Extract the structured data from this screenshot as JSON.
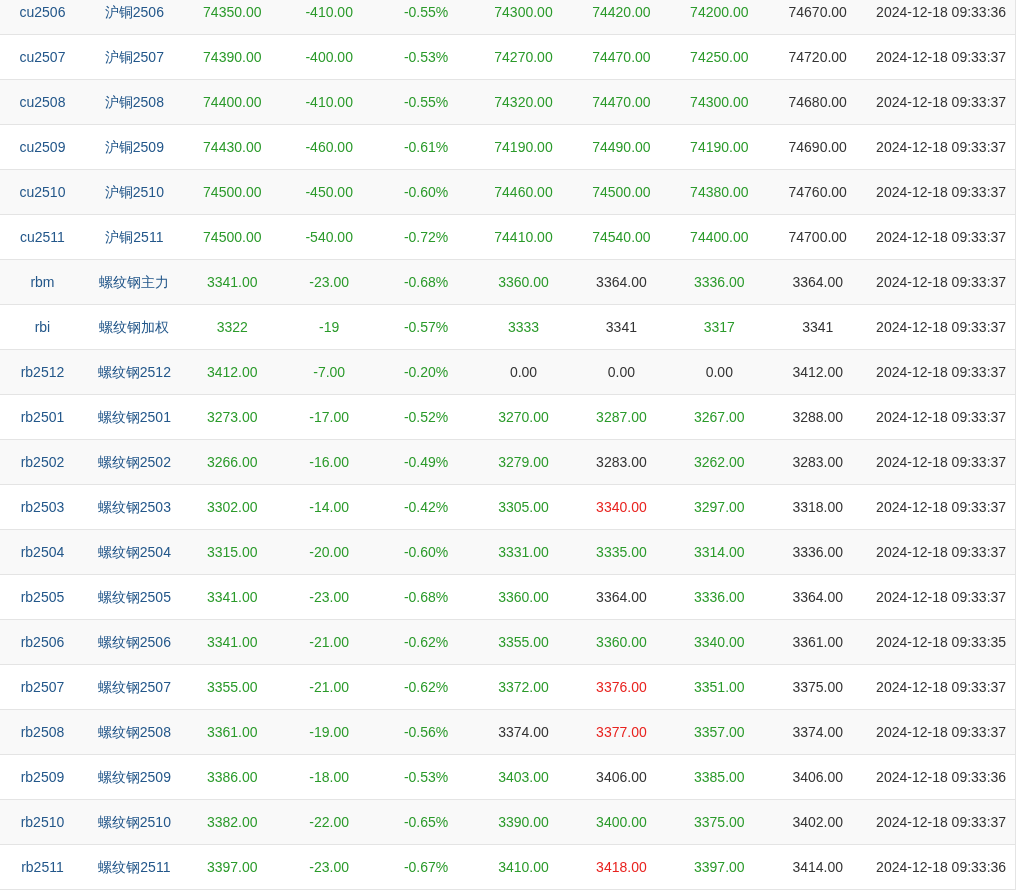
{
  "rows": [
    {
      "code": "cu2506",
      "name": "沪铜2506",
      "quotes": [
        {
          "value": "74350.00",
          "color": "#2a9a2a"
        },
        {
          "value": "-410.00",
          "color": "#2a9a2a"
        },
        {
          "value": "-0.55%",
          "color": "#2a9a2a"
        },
        {
          "value": "74300.00",
          "color": "#2a9a2a"
        },
        {
          "value": "74420.00",
          "color": "#2a9a2a"
        },
        {
          "value": "74200.00",
          "color": "#2a9a2a"
        },
        {
          "value": "74670.00",
          "color": "#333333"
        }
      ],
      "time": "2024-12-18 09:33:36"
    },
    {
      "code": "cu2507",
      "name": "沪铜2507",
      "quotes": [
        {
          "value": "74390.00",
          "color": "#2a9a2a"
        },
        {
          "value": "-400.00",
          "color": "#2a9a2a"
        },
        {
          "value": "-0.53%",
          "color": "#2a9a2a"
        },
        {
          "value": "74270.00",
          "color": "#2a9a2a"
        },
        {
          "value": "74470.00",
          "color": "#2a9a2a"
        },
        {
          "value": "74250.00",
          "color": "#2a9a2a"
        },
        {
          "value": "74720.00",
          "color": "#333333"
        }
      ],
      "time": "2024-12-18 09:33:37"
    },
    {
      "code": "cu2508",
      "name": "沪铜2508",
      "quotes": [
        {
          "value": "74400.00",
          "color": "#2a9a2a"
        },
        {
          "value": "-410.00",
          "color": "#2a9a2a"
        },
        {
          "value": "-0.55%",
          "color": "#2a9a2a"
        },
        {
          "value": "74320.00",
          "color": "#2a9a2a"
        },
        {
          "value": "74470.00",
          "color": "#2a9a2a"
        },
        {
          "value": "74300.00",
          "color": "#2a9a2a"
        },
        {
          "value": "74680.00",
          "color": "#333333"
        }
      ],
      "time": "2024-12-18 09:33:37"
    },
    {
      "code": "cu2509",
      "name": "沪铜2509",
      "quotes": [
        {
          "value": "74430.00",
          "color": "#2a9a2a"
        },
        {
          "value": "-460.00",
          "color": "#2a9a2a"
        },
        {
          "value": "-0.61%",
          "color": "#2a9a2a"
        },
        {
          "value": "74190.00",
          "color": "#2a9a2a"
        },
        {
          "value": "74490.00",
          "color": "#2a9a2a"
        },
        {
          "value": "74190.00",
          "color": "#2a9a2a"
        },
        {
          "value": "74690.00",
          "color": "#333333"
        }
      ],
      "time": "2024-12-18 09:33:37"
    },
    {
      "code": "cu2510",
      "name": "沪铜2510",
      "quotes": [
        {
          "value": "74500.00",
          "color": "#2a9a2a"
        },
        {
          "value": "-450.00",
          "color": "#2a9a2a"
        },
        {
          "value": "-0.60%",
          "color": "#2a9a2a"
        },
        {
          "value": "74460.00",
          "color": "#2a9a2a"
        },
        {
          "value": "74500.00",
          "color": "#2a9a2a"
        },
        {
          "value": "74380.00",
          "color": "#2a9a2a"
        },
        {
          "value": "74760.00",
          "color": "#333333"
        }
      ],
      "time": "2024-12-18 09:33:37"
    },
    {
      "code": "cu2511",
      "name": "沪铜2511",
      "quotes": [
        {
          "value": "74500.00",
          "color": "#2a9a2a"
        },
        {
          "value": "-540.00",
          "color": "#2a9a2a"
        },
        {
          "value": "-0.72%",
          "color": "#2a9a2a"
        },
        {
          "value": "74410.00",
          "color": "#2a9a2a"
        },
        {
          "value": "74540.00",
          "color": "#2a9a2a"
        },
        {
          "value": "74400.00",
          "color": "#2a9a2a"
        },
        {
          "value": "74700.00",
          "color": "#333333"
        }
      ],
      "time": "2024-12-18 09:33:37"
    },
    {
      "code": "rbm",
      "name": "螺纹钢主力",
      "quotes": [
        {
          "value": "3341.00",
          "color": "#2a9a2a"
        },
        {
          "value": "-23.00",
          "color": "#2a9a2a"
        },
        {
          "value": "-0.68%",
          "color": "#2a9a2a"
        },
        {
          "value": "3360.00",
          "color": "#2a9a2a"
        },
        {
          "value": "3364.00",
          "color": "#333333"
        },
        {
          "value": "3336.00",
          "color": "#2a9a2a"
        },
        {
          "value": "3364.00",
          "color": "#333333"
        }
      ],
      "time": "2024-12-18 09:33:37"
    },
    {
      "code": "rbi",
      "name": "螺纹钢加权",
      "quotes": [
        {
          "value": "3322",
          "color": "#2a9a2a"
        },
        {
          "value": "-19",
          "color": "#2a9a2a"
        },
        {
          "value": "-0.57%",
          "color": "#2a9a2a"
        },
        {
          "value": "3333",
          "color": "#2a9a2a"
        },
        {
          "value": "3341",
          "color": "#333333"
        },
        {
          "value": "3317",
          "color": "#2a9a2a"
        },
        {
          "value": "3341",
          "color": "#333333"
        }
      ],
      "time": "2024-12-18 09:33:37"
    },
    {
      "code": "rb2512",
      "name": "螺纹钢2512",
      "quotes": [
        {
          "value": "3412.00",
          "color": "#2a9a2a"
        },
        {
          "value": "-7.00",
          "color": "#2a9a2a"
        },
        {
          "value": "-0.20%",
          "color": "#2a9a2a"
        },
        {
          "value": "0.00",
          "color": "#333333"
        },
        {
          "value": "0.00",
          "color": "#333333"
        },
        {
          "value": "0.00",
          "color": "#333333"
        },
        {
          "value": "3412.00",
          "color": "#333333"
        }
      ],
      "time": "2024-12-18 09:33:37"
    },
    {
      "code": "rb2501",
      "name": "螺纹钢2501",
      "quotes": [
        {
          "value": "3273.00",
          "color": "#2a9a2a"
        },
        {
          "value": "-17.00",
          "color": "#2a9a2a"
        },
        {
          "value": "-0.52%",
          "color": "#2a9a2a"
        },
        {
          "value": "3270.00",
          "color": "#2a9a2a"
        },
        {
          "value": "3287.00",
          "color": "#2a9a2a"
        },
        {
          "value": "3267.00",
          "color": "#2a9a2a"
        },
        {
          "value": "3288.00",
          "color": "#333333"
        }
      ],
      "time": "2024-12-18 09:33:37"
    },
    {
      "code": "rb2502",
      "name": "螺纹钢2502",
      "quotes": [
        {
          "value": "3266.00",
          "color": "#2a9a2a"
        },
        {
          "value": "-16.00",
          "color": "#2a9a2a"
        },
        {
          "value": "-0.49%",
          "color": "#2a9a2a"
        },
        {
          "value": "3279.00",
          "color": "#2a9a2a"
        },
        {
          "value": "3283.00",
          "color": "#333333"
        },
        {
          "value": "3262.00",
          "color": "#2a9a2a"
        },
        {
          "value": "3283.00",
          "color": "#333333"
        }
      ],
      "time": "2024-12-18 09:33:37"
    },
    {
      "code": "rb2503",
      "name": "螺纹钢2503",
      "quotes": [
        {
          "value": "3302.00",
          "color": "#2a9a2a"
        },
        {
          "value": "-14.00",
          "color": "#2a9a2a"
        },
        {
          "value": "-0.42%",
          "color": "#2a9a2a"
        },
        {
          "value": "3305.00",
          "color": "#2a9a2a"
        },
        {
          "value": "3340.00",
          "color": "#e8221e"
        },
        {
          "value": "3297.00",
          "color": "#2a9a2a"
        },
        {
          "value": "3318.00",
          "color": "#333333"
        }
      ],
      "time": "2024-12-18 09:33:37"
    },
    {
      "code": "rb2504",
      "name": "螺纹钢2504",
      "quotes": [
        {
          "value": "3315.00",
          "color": "#2a9a2a"
        },
        {
          "value": "-20.00",
          "color": "#2a9a2a"
        },
        {
          "value": "-0.60%",
          "color": "#2a9a2a"
        },
        {
          "value": "3331.00",
          "color": "#2a9a2a"
        },
        {
          "value": "3335.00",
          "color": "#2a9a2a"
        },
        {
          "value": "3314.00",
          "color": "#2a9a2a"
        },
        {
          "value": "3336.00",
          "color": "#333333"
        }
      ],
      "time": "2024-12-18 09:33:37"
    },
    {
      "code": "rb2505",
      "name": "螺纹钢2505",
      "quotes": [
        {
          "value": "3341.00",
          "color": "#2a9a2a"
        },
        {
          "value": "-23.00",
          "color": "#2a9a2a"
        },
        {
          "value": "-0.68%",
          "color": "#2a9a2a"
        },
        {
          "value": "3360.00",
          "color": "#2a9a2a"
        },
        {
          "value": "3364.00",
          "color": "#333333"
        },
        {
          "value": "3336.00",
          "color": "#2a9a2a"
        },
        {
          "value": "3364.00",
          "color": "#333333"
        }
      ],
      "time": "2024-12-18 09:33:37"
    },
    {
      "code": "rb2506",
      "name": "螺纹钢2506",
      "quotes": [
        {
          "value": "3341.00",
          "color": "#2a9a2a"
        },
        {
          "value": "-21.00",
          "color": "#2a9a2a"
        },
        {
          "value": "-0.62%",
          "color": "#2a9a2a"
        },
        {
          "value": "3355.00",
          "color": "#2a9a2a"
        },
        {
          "value": "3360.00",
          "color": "#2a9a2a"
        },
        {
          "value": "3340.00",
          "color": "#2a9a2a"
        },
        {
          "value": "3361.00",
          "color": "#333333"
        }
      ],
      "time": "2024-12-18 09:33:35"
    },
    {
      "code": "rb2507",
      "name": "螺纹钢2507",
      "quotes": [
        {
          "value": "3355.00",
          "color": "#2a9a2a"
        },
        {
          "value": "-21.00",
          "color": "#2a9a2a"
        },
        {
          "value": "-0.62%",
          "color": "#2a9a2a"
        },
        {
          "value": "3372.00",
          "color": "#2a9a2a"
        },
        {
          "value": "3376.00",
          "color": "#e8221e"
        },
        {
          "value": "3351.00",
          "color": "#2a9a2a"
        },
        {
          "value": "3375.00",
          "color": "#333333"
        }
      ],
      "time": "2024-12-18 09:33:37"
    },
    {
      "code": "rb2508",
      "name": "螺纹钢2508",
      "quotes": [
        {
          "value": "3361.00",
          "color": "#2a9a2a"
        },
        {
          "value": "-19.00",
          "color": "#2a9a2a"
        },
        {
          "value": "-0.56%",
          "color": "#2a9a2a"
        },
        {
          "value": "3374.00",
          "color": "#333333"
        },
        {
          "value": "3377.00",
          "color": "#e8221e"
        },
        {
          "value": "3357.00",
          "color": "#2a9a2a"
        },
        {
          "value": "3374.00",
          "color": "#333333"
        }
      ],
      "time": "2024-12-18 09:33:37"
    },
    {
      "code": "rb2509",
      "name": "螺纹钢2509",
      "quotes": [
        {
          "value": "3386.00",
          "color": "#2a9a2a"
        },
        {
          "value": "-18.00",
          "color": "#2a9a2a"
        },
        {
          "value": "-0.53%",
          "color": "#2a9a2a"
        },
        {
          "value": "3403.00",
          "color": "#2a9a2a"
        },
        {
          "value": "3406.00",
          "color": "#333333"
        },
        {
          "value": "3385.00",
          "color": "#2a9a2a"
        },
        {
          "value": "3406.00",
          "color": "#333333"
        }
      ],
      "time": "2024-12-18 09:33:36"
    },
    {
      "code": "rb2510",
      "name": "螺纹钢2510",
      "quotes": [
        {
          "value": "3382.00",
          "color": "#2a9a2a"
        },
        {
          "value": "-22.00",
          "color": "#2a9a2a"
        },
        {
          "value": "-0.65%",
          "color": "#2a9a2a"
        },
        {
          "value": "3390.00",
          "color": "#2a9a2a"
        },
        {
          "value": "3400.00",
          "color": "#2a9a2a"
        },
        {
          "value": "3375.00",
          "color": "#2a9a2a"
        },
        {
          "value": "3402.00",
          "color": "#333333"
        }
      ],
      "time": "2024-12-18 09:33:37"
    },
    {
      "code": "rb2511",
      "name": "螺纹钢2511",
      "quotes": [
        {
          "value": "3397.00",
          "color": "#2a9a2a"
        },
        {
          "value": "-23.00",
          "color": "#2a9a2a"
        },
        {
          "value": "-0.67%",
          "color": "#2a9a2a"
        },
        {
          "value": "3410.00",
          "color": "#2a9a2a"
        },
        {
          "value": "3418.00",
          "color": "#e8221e"
        },
        {
          "value": "3397.00",
          "color": "#2a9a2a"
        },
        {
          "value": "3414.00",
          "color": "#333333"
        }
      ],
      "time": "2024-12-18 09:33:36"
    }
  ]
}
